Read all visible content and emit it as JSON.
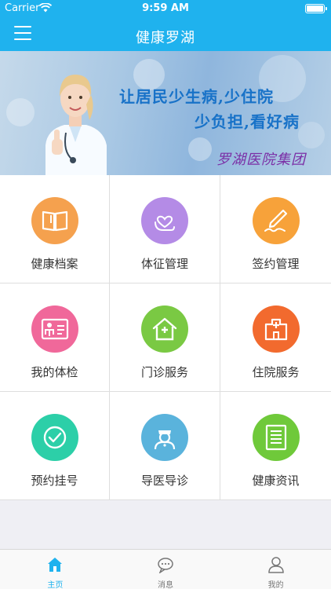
{
  "status_bar": {
    "carrier": "Carrier",
    "time": "9:59 AM"
  },
  "header": {
    "title": "健康罗湖",
    "menu_icon": "hamburger-menu-icon"
  },
  "banner": {
    "line1": "让居民少生病,少住院",
    "line2": "少负担,看好病",
    "organization": "罗湖医院集团",
    "page_dots": 2,
    "active_dot": 1
  },
  "grid": {
    "items": [
      {
        "label": "健康档案",
        "icon": "book-icon",
        "color": "#f5a14e"
      },
      {
        "label": "体征管理",
        "icon": "heart-hand-icon",
        "color": "#b48be6"
      },
      {
        "label": "签约管理",
        "icon": "pen-sign-icon",
        "color": "#f7a23a"
      },
      {
        "label": "我的体检",
        "icon": "id-card-icon",
        "color": "#f0689a"
      },
      {
        "label": "门诊服务",
        "icon": "clinic-house-icon",
        "color": "#7ac943"
      },
      {
        "label": "住院服务",
        "icon": "hospital-building-icon",
        "color": "#f26a2e"
      },
      {
        "label": "预约挂号",
        "icon": "clock-icon",
        "color": "#2ccfa8"
      },
      {
        "label": "导医导诊",
        "icon": "nurse-icon",
        "color": "#5ab3dc"
      },
      {
        "label": "健康资讯",
        "icon": "document-icon",
        "color": "#6fc93a"
      }
    ]
  },
  "tabbar": {
    "tabs": [
      {
        "label": "主页",
        "icon": "home-icon",
        "active": true
      },
      {
        "label": "消息",
        "icon": "chat-bubble-icon",
        "active": false
      },
      {
        "label": "我的",
        "icon": "person-icon",
        "active": false
      }
    ]
  },
  "colors": {
    "primary": "#1fb2ee",
    "background": "#efeff4"
  }
}
